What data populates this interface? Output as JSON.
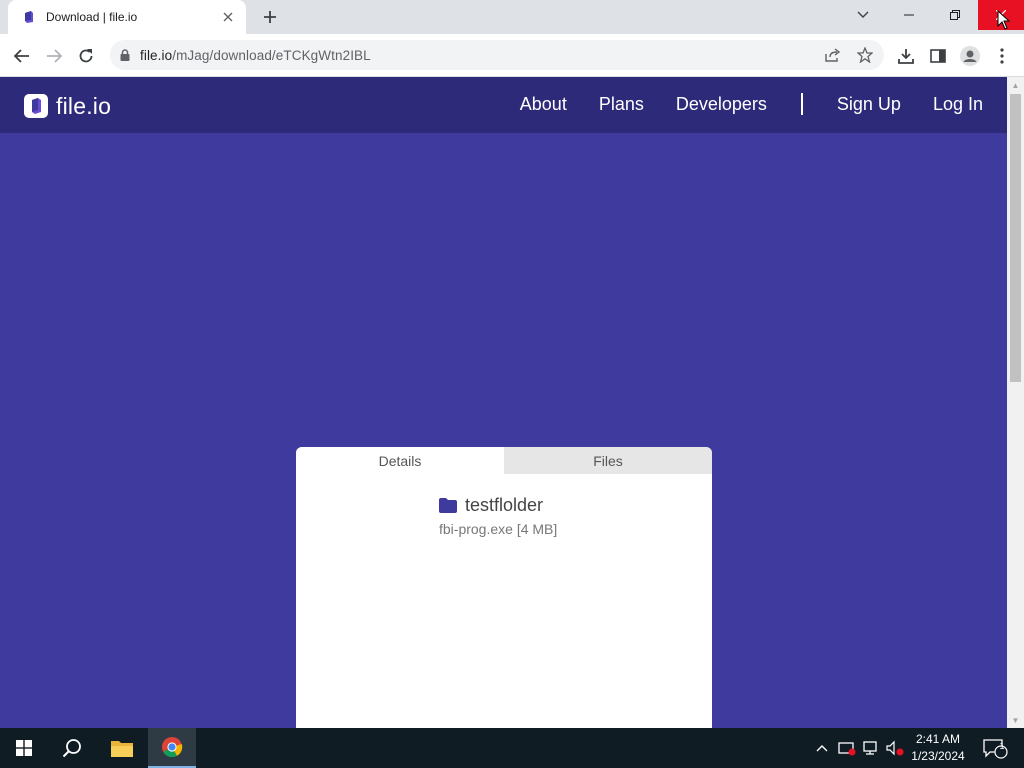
{
  "browser": {
    "tab_title": "Download | file.io",
    "url_host": "file.io",
    "url_path": "/mJag/download/eTCKgWtn2IBL"
  },
  "site": {
    "logo_text": "file.io",
    "nav": {
      "about": "About",
      "plans": "Plans",
      "developers": "Developers",
      "signup": "Sign Up",
      "login": "Log In"
    },
    "colors": {
      "page_bg": "#3f3a9e",
      "navbar_bg": "#2e2a7a"
    }
  },
  "download_card": {
    "tabs": {
      "details": "Details",
      "files": "Files"
    },
    "folder_name": "testflolder",
    "file_line": "fbi-prog.exe [4 MB]"
  },
  "taskbar": {
    "time": "2:41 AM",
    "date": "1/23/2024",
    "notification_count": "1"
  }
}
